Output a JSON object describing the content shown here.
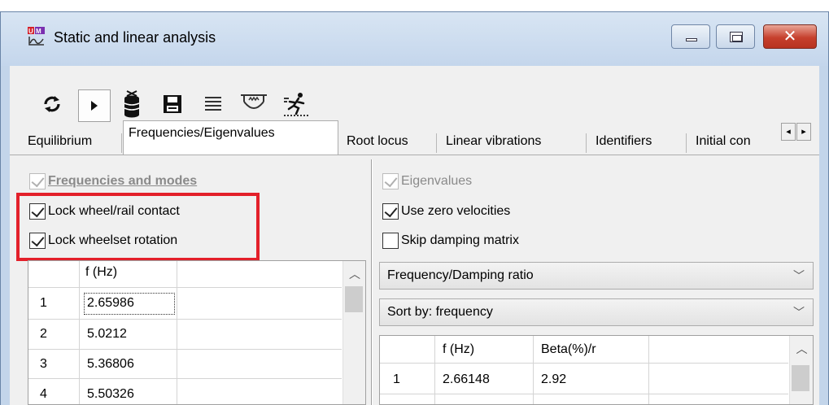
{
  "window": {
    "title": "Static and linear analysis",
    "buttons": {
      "minimize": "minimize",
      "maximize": "maximize",
      "close_glyph": "✕"
    }
  },
  "toolbar": {
    "icons": [
      "refresh-icon",
      "run-icon",
      "clear-database-icon",
      "save-icon",
      "list-icon",
      "suspension-icon",
      "animation-runner-icon"
    ]
  },
  "tabs": [
    {
      "label": "Equilibrium",
      "active": false
    },
    {
      "label": "Frequencies/Eigenvalues",
      "active": true
    },
    {
      "label": "Root locus",
      "active": false
    },
    {
      "label": "Linear vibrations",
      "active": false
    },
    {
      "label": "Identifiers",
      "active": false
    },
    {
      "label": "Initial con",
      "active": false
    }
  ],
  "tab_scroll": {
    "left": "◂",
    "right": "▸"
  },
  "left_panel": {
    "header_checkbox": {
      "label": "Frequencies and modes",
      "checked": true,
      "enabled": false
    },
    "options": [
      {
        "label": "Lock wheel/rail contact",
        "checked": true
      },
      {
        "label": "Lock wheelset rotation",
        "checked": true
      }
    ],
    "grid": {
      "column_header": "f (Hz)",
      "rows": [
        {
          "index": "1",
          "value": "2.65986"
        },
        {
          "index": "2",
          "value": "5.0212"
        },
        {
          "index": "3",
          "value": "5.36806"
        },
        {
          "index": "4",
          "value": "5.50326"
        }
      ]
    }
  },
  "right_panel": {
    "header_checkbox": {
      "label": "Eigenvalues",
      "checked": true,
      "enabled": false
    },
    "options": [
      {
        "label": "Use zero velocities",
        "checked": true
      },
      {
        "label": "Skip damping matrix",
        "checked": false
      }
    ],
    "display_combo": "Frequency/Damping ratio",
    "sort_combo": "Sort by: frequency",
    "grid": {
      "headers": [
        "f (Hz)",
        "Beta(%)/r"
      ],
      "rows": [
        {
          "index": "1",
          "f": "2.66148",
          "beta": "2.92"
        }
      ]
    }
  },
  "colors": {
    "highlight_box": "#e3202a",
    "title_bar": "#c4d6ec",
    "close_button": "#c6402d"
  }
}
